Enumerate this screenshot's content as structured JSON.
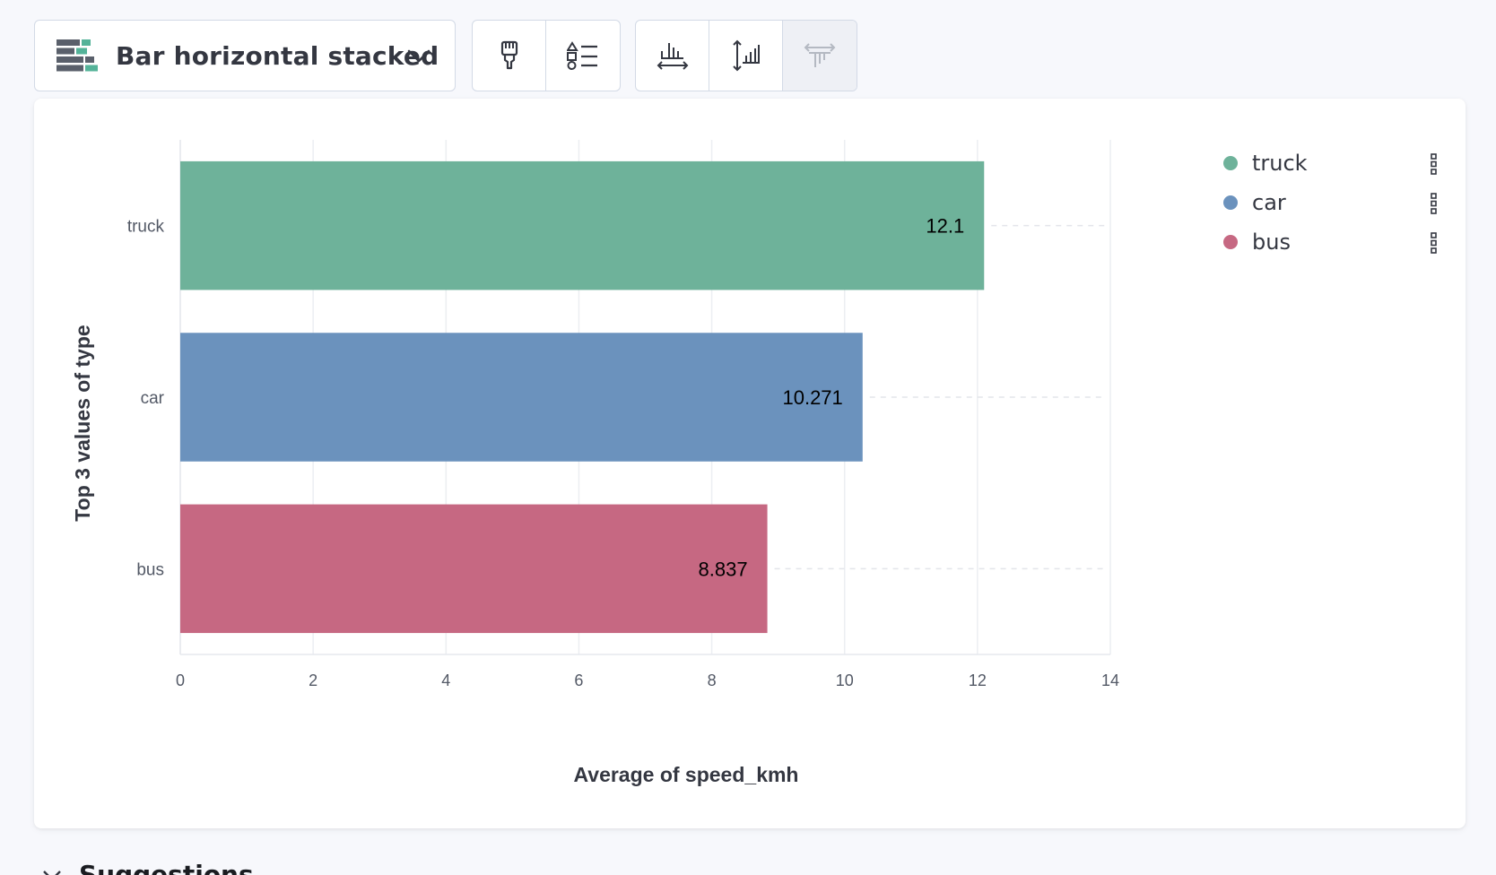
{
  "toolbar": {
    "chart_type_label": "Bar horizontal stacked",
    "icons": {
      "chart_type": "bar-horizontal-stacked-icon",
      "dropdown": "chevron-down-icon",
      "visual_options": "paintbrush-icon",
      "legend_settings": "legend-list-icon",
      "bottom_axis": "horizontal-axis-icon",
      "left_axis": "vertical-left-axis-icon",
      "right_axis": "vertical-right-axis-icon"
    }
  },
  "legend": {
    "items": [
      {
        "name": "truck",
        "color": "#6eb29a"
      },
      {
        "name": "car",
        "color": "#6b92bd"
      },
      {
        "name": "bus",
        "color": "#c66882"
      }
    ]
  },
  "suggestions": {
    "title": "Suggestions"
  },
  "chart_data": {
    "type": "bar",
    "orientation": "horizontal",
    "categories": [
      "truck",
      "car",
      "bus"
    ],
    "values": [
      12.1,
      10.271,
      8.837
    ],
    "value_labels": [
      "12.1",
      "10.271",
      "8.837"
    ],
    "colors": [
      "#6eb29a",
      "#6b92bd",
      "#c66882"
    ],
    "xlabel": "Average of speed_kmh",
    "ylabel": "Top 3 values of type",
    "xlim": [
      0,
      14
    ],
    "xticks": [
      0,
      2,
      4,
      6,
      8,
      10,
      12,
      14
    ],
    "grid": true,
    "legend_position": "right"
  }
}
